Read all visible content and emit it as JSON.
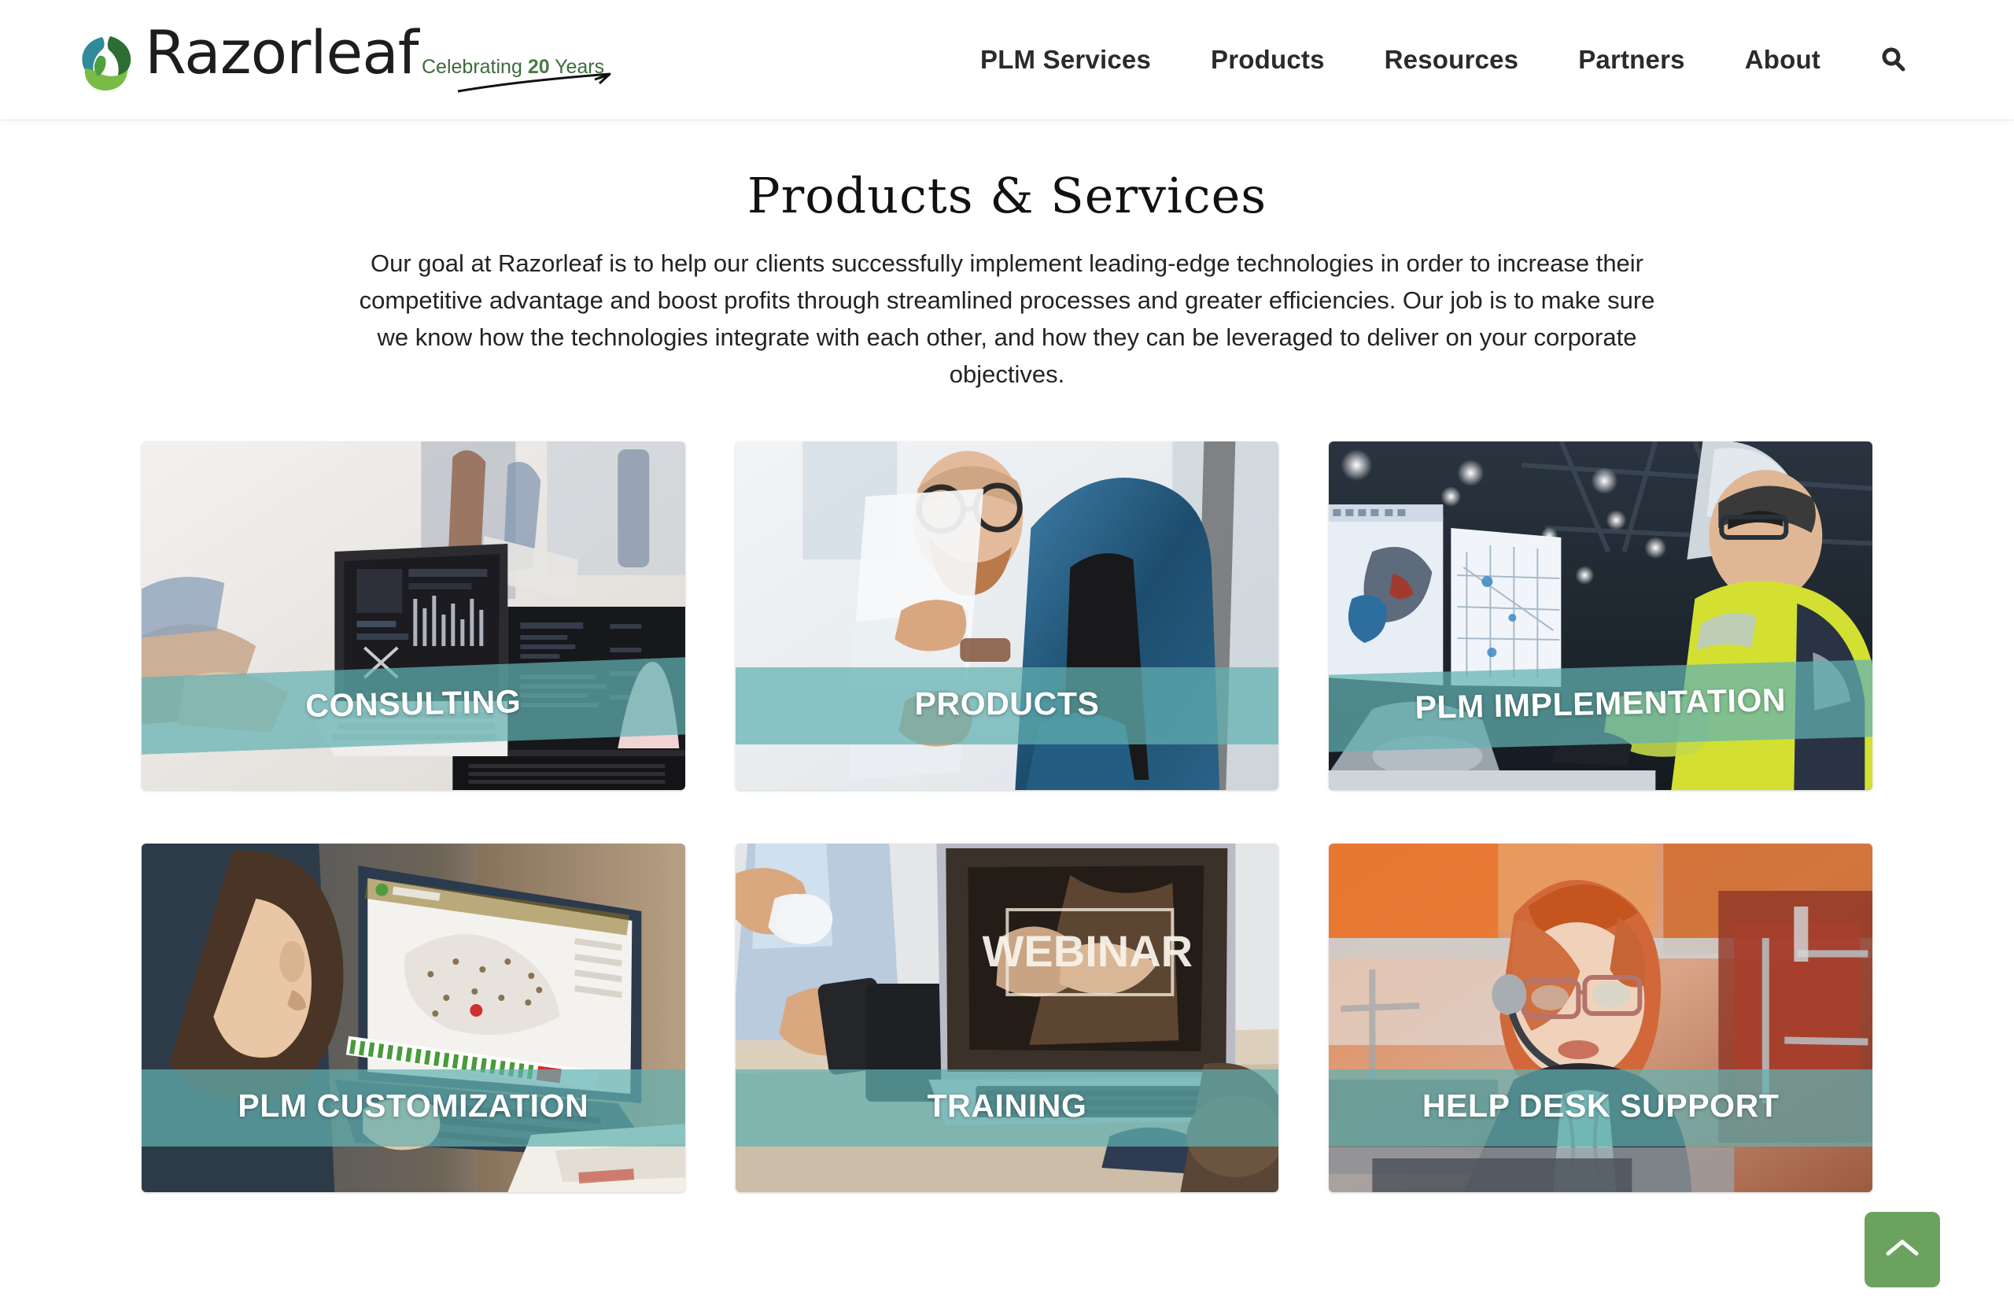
{
  "header": {
    "logo": {
      "wordmark": "Razorleaf",
      "tagline_pre": "Celebrating ",
      "tagline_num": "20",
      "tagline_post": " Years",
      "mark_icon": "razorleaf-leaf-swirl-icon"
    },
    "nav": [
      {
        "label": "PLM Services"
      },
      {
        "label": "Products"
      },
      {
        "label": "Resources"
      },
      {
        "label": "Partners"
      },
      {
        "label": "About"
      }
    ],
    "search_icon": "search-icon"
  },
  "main": {
    "title": "Products & Services",
    "intro": "Our goal at Razorleaf is to help our clients successfully implement leading-edge technologies in order to increase their competitive advantage and boost profits through streamlined processes and greater efficiencies. Our job is to make sure we know how the technologies integrate with each other, and how they can be leveraged to deliver on your corporate objectives.",
    "cards": [
      {
        "label": "CONSULTING",
        "image_alt": "team working on laptop with analytics dashboards"
      },
      {
        "label": "PRODUCTS",
        "image_alt": "bearded man with glasses in denim jacket holding documents"
      },
      {
        "label": "PLM IMPLEMENTATION",
        "image_alt": "engineer in hi-vis jacket and hard hat at CAD monitors in factory"
      },
      {
        "label": "PLM CUSTOMIZATION",
        "image_alt": "person viewing laptop showing US map dashboard"
      },
      {
        "label": "TRAINING",
        "image_alt": "laptop displaying WEBINAR screen on meeting table"
      },
      {
        "label": "HELP DESK SUPPORT",
        "image_alt": "woman with headset and glasses at support desk"
      }
    ]
  },
  "scroll_top": {
    "icon": "chevron-up-icon"
  },
  "colors": {
    "banner_teal": "#62b2b2",
    "scroll_top_green": "#6ba35e",
    "logo_green": "#4a7a44",
    "text_dark": "#222222"
  }
}
